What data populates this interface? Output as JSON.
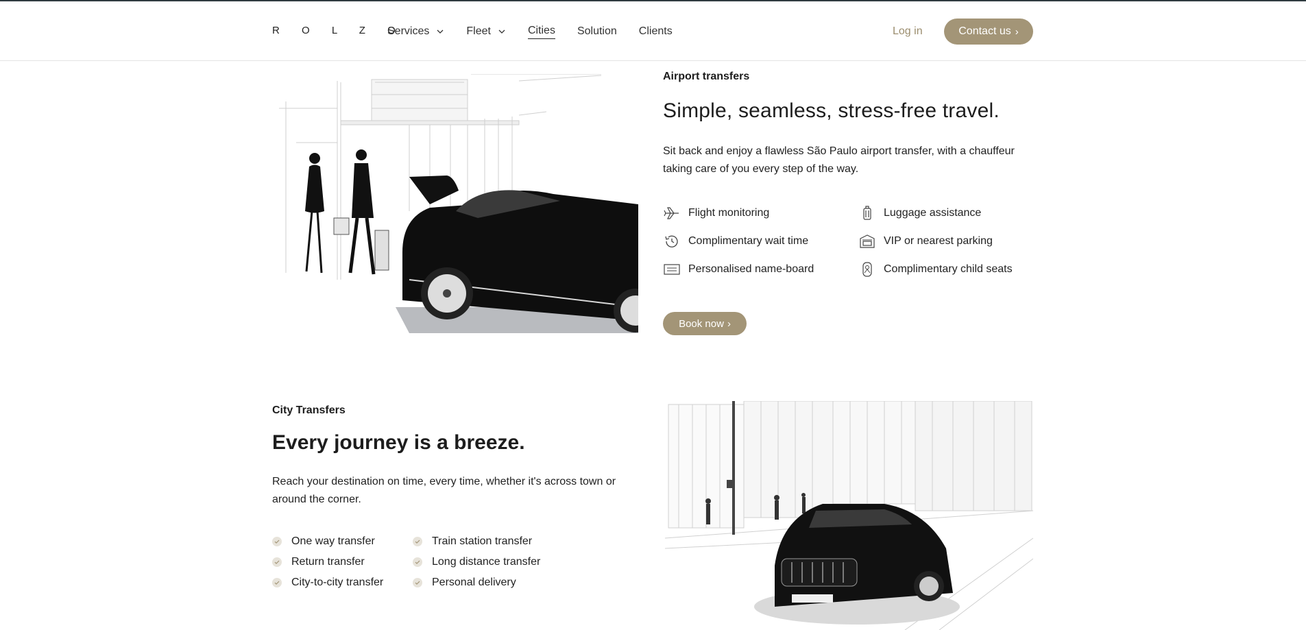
{
  "header": {
    "logo": "R O L Z O",
    "nav": [
      {
        "label": "Services",
        "dropdown": true
      },
      {
        "label": "Fleet",
        "dropdown": true
      },
      {
        "label": "Cities",
        "dropdown": false,
        "active": true
      },
      {
        "label": "Solution",
        "dropdown": false
      },
      {
        "label": "Clients",
        "dropdown": false
      }
    ],
    "login": "Log in",
    "contact": "Contact us",
    "accent_color": "#a39577"
  },
  "airport": {
    "eyebrow": "Airport transfers",
    "title": "Simple, seamless, stress-free travel.",
    "description": "Sit back and enjoy a flawless São Paulo airport transfer, with a chauffeur taking care of you every step of the way.",
    "features": [
      {
        "label": "Flight monitoring",
        "icon": "airplane-icon"
      },
      {
        "label": "Luggage assistance",
        "icon": "luggage-icon"
      },
      {
        "label": "Complimentary wait time",
        "icon": "history-clock-icon"
      },
      {
        "label": "VIP or nearest parking",
        "icon": "garage-icon"
      },
      {
        "label": "Personalised name-board",
        "icon": "name-board-icon"
      },
      {
        "label": "Complimentary child seats",
        "icon": "child-seat-icon"
      }
    ],
    "book": "Book now"
  },
  "city": {
    "eyebrow": "City Transfers",
    "title": "Every journey is a breeze.",
    "description": "Reach your destination on time, every time, whether it's across town or around the corner.",
    "items": [
      "One way transfer",
      "Train station transfer",
      "Return transfer",
      "Long distance transfer",
      "City-to-city transfer",
      "Personal delivery"
    ]
  }
}
